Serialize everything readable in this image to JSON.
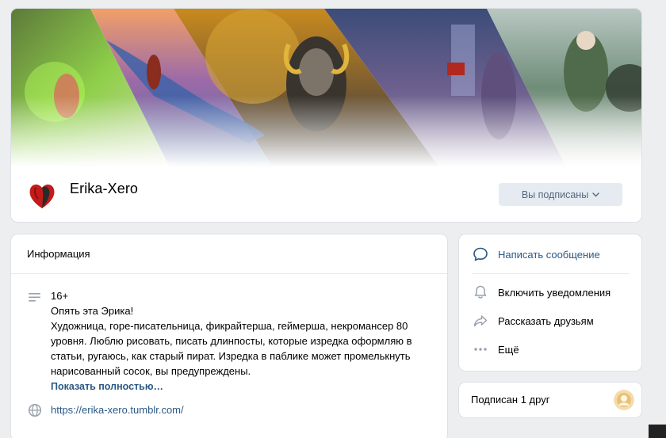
{
  "header": {
    "title": "Erika-Xero",
    "subscribe_button": "Вы подписаны"
  },
  "info": {
    "heading": "Информация",
    "age": "16+",
    "description": "Опять эта Эрика!\nХудожница, горе-писательница, фикрайтерша, геймерша, некромансер 80 уровня. Люблю рисовать, писать длинпосты, которые изредка оформляю в статьи, ругаюсь, как старый пират. Изредка в паблике может промелькнуть нарисованный сосок, вы предупреждены.",
    "show_more": "Показать полностью…",
    "website": "https://erika-xero.tumblr.com/"
  },
  "actions": {
    "message": "Написать сообщение",
    "notifications": "Включить уведомления",
    "share": "Рассказать друзьям",
    "more": "Ещё"
  },
  "friends": {
    "label": "Подписан 1 друг"
  },
  "colors": {
    "accent": "#2a5885",
    "background": "#edeef0",
    "button_bg": "#e5ebf1",
    "icon": "#99a2ad"
  }
}
